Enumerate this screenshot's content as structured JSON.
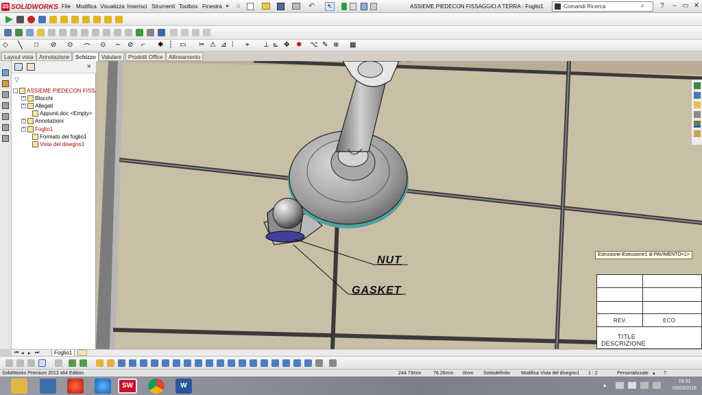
{
  "app": {
    "brand": "SOLIDWORKS",
    "document_title": "ASSIEME PIEDECON FISSAGGIO A TERRA - Foglio1",
    "search_placeholder": "Comandi Ricerca",
    "brand_color": "#c8102e"
  },
  "menu": [
    "File",
    "Modifica",
    "Visualizza",
    "Inserisci",
    "Strumenti",
    "Toolbox",
    "Finestra"
  ],
  "tabs": [
    {
      "label": "Layout vista",
      "active": false
    },
    {
      "label": "Annotazione",
      "active": false
    },
    {
      "label": "Schizzo",
      "active": true
    },
    {
      "label": "Valutare",
      "active": false
    },
    {
      "label": "Prodotti Office",
      "active": false
    },
    {
      "label": "Allineamento",
      "active": false
    }
  ],
  "feature_tree": {
    "items": [
      {
        "label": "ASSIEME PIEDECON FISSAGG",
        "level": 0,
        "color": "#b00000"
      },
      {
        "label": "Blocchi",
        "level": 1,
        "color": "#000"
      },
      {
        "label": "Allegati",
        "level": 1,
        "color": "#000"
      },
      {
        "label": "Appunti.doc <Empty>",
        "level": 2,
        "color": "#000"
      },
      {
        "label": "Annotazioni",
        "level": 1,
        "color": "#000"
      },
      {
        "label": "Foglio1",
        "level": 1,
        "color": "#b00000"
      },
      {
        "label": "Formato del foglio1",
        "level": 2,
        "color": "#000"
      },
      {
        "label": "Vista del disegno1",
        "level": 2,
        "color": "#b00000"
      }
    ]
  },
  "drawing": {
    "callouts": {
      "nut": "NUT",
      "gasket": "GASKET"
    },
    "tooltip": "Estrusione-Estrusione1 di PAVIMENTO<1>",
    "titleblock": {
      "rev": "REV.",
      "eco": "ECO",
      "title": "TITLE",
      "desc": "DESCRIZIONE"
    }
  },
  "sheet_tab": "Foglio1",
  "status": {
    "edition": "SolidWorks Premium 2013 x64 Edition",
    "x": "244.73mm",
    "y": "76.26mm",
    "z": "0mm",
    "state": "Sottodefinito",
    "mode": "Modifica Vista del disegno1",
    "scale": "1 : 2",
    "units": "Personalizzate"
  },
  "taskbar": {
    "time": "19.31",
    "date": "03/03/2016"
  }
}
